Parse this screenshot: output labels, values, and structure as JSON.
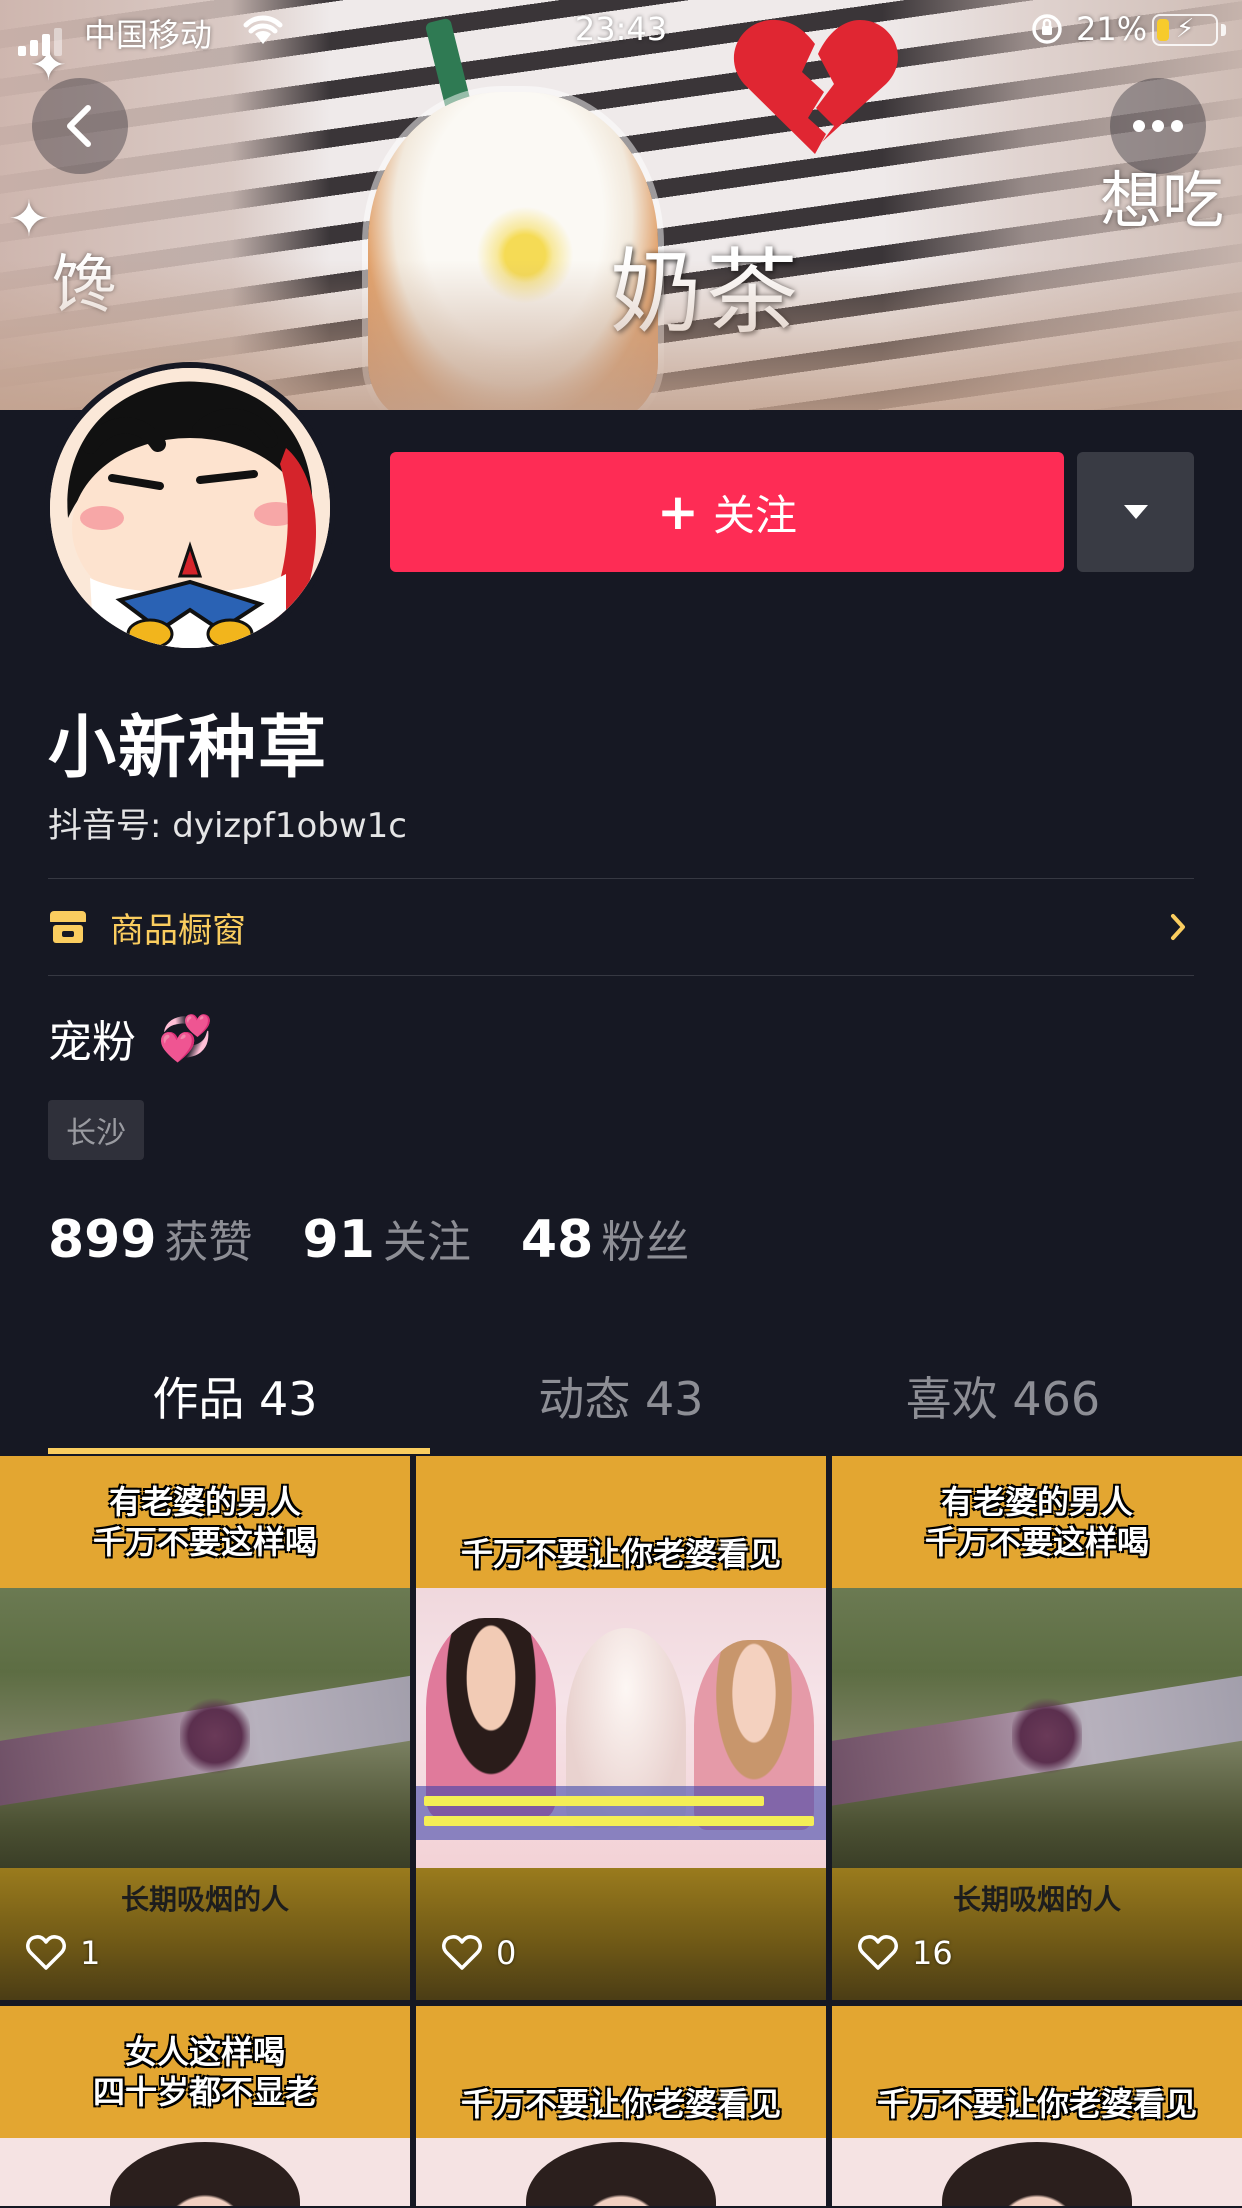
{
  "status_bar": {
    "carrier": "中国移动",
    "time": "23:43",
    "battery_percent": "21%",
    "battery_level": 0.21
  },
  "banner": {
    "overlay_text_main": "奶茶",
    "overlay_text_left": "馋",
    "overlay_text_right": "想吃"
  },
  "nav": {
    "back_icon": "chevron-left-icon",
    "more_icon": "more-dots-icon"
  },
  "profile": {
    "follow_label": "关注",
    "nickname": "小新种草",
    "douyin_id": "抖音号: dyizpf1obw1c",
    "shop_window_label": "商品橱窗",
    "bio": "宠粉",
    "bio_emoji": "💞",
    "location": "长沙"
  },
  "stats": [
    {
      "num": "899",
      "label": "获赞"
    },
    {
      "num": "91",
      "label": "关注"
    },
    {
      "num": "48",
      "label": "粉丝"
    }
  ],
  "tabs": [
    {
      "label": "作品 43",
      "active": true
    },
    {
      "label": "动态 43",
      "active": false
    },
    {
      "label": "喜欢 466",
      "active": false
    }
  ],
  "videos": [
    {
      "top_line1": "有老婆的男人",
      "top_line2": "千万不要这样喝",
      "bottom_caption": "长期吸烟的人",
      "likes": "1"
    },
    {
      "top_line1": "",
      "top_line2": "千万不要让你老婆看见",
      "bottom_caption": "",
      "likes": "0"
    },
    {
      "top_line1": "有老婆的男人",
      "top_line2": "千万不要这样喝",
      "bottom_caption": "长期吸烟的人",
      "likes": "16"
    },
    {
      "top_line1": "女人这样喝",
      "top_line2": "四十岁都不显老"
    },
    {
      "top_line1": "",
      "top_line2": "千万不要让你老婆看见"
    },
    {
      "top_line1": "",
      "top_line2": "千万不要让你老婆看见"
    }
  ],
  "colors": {
    "background": "#161823",
    "follow_button": "#fe2c55",
    "accent_yellow": "#facd5f"
  }
}
